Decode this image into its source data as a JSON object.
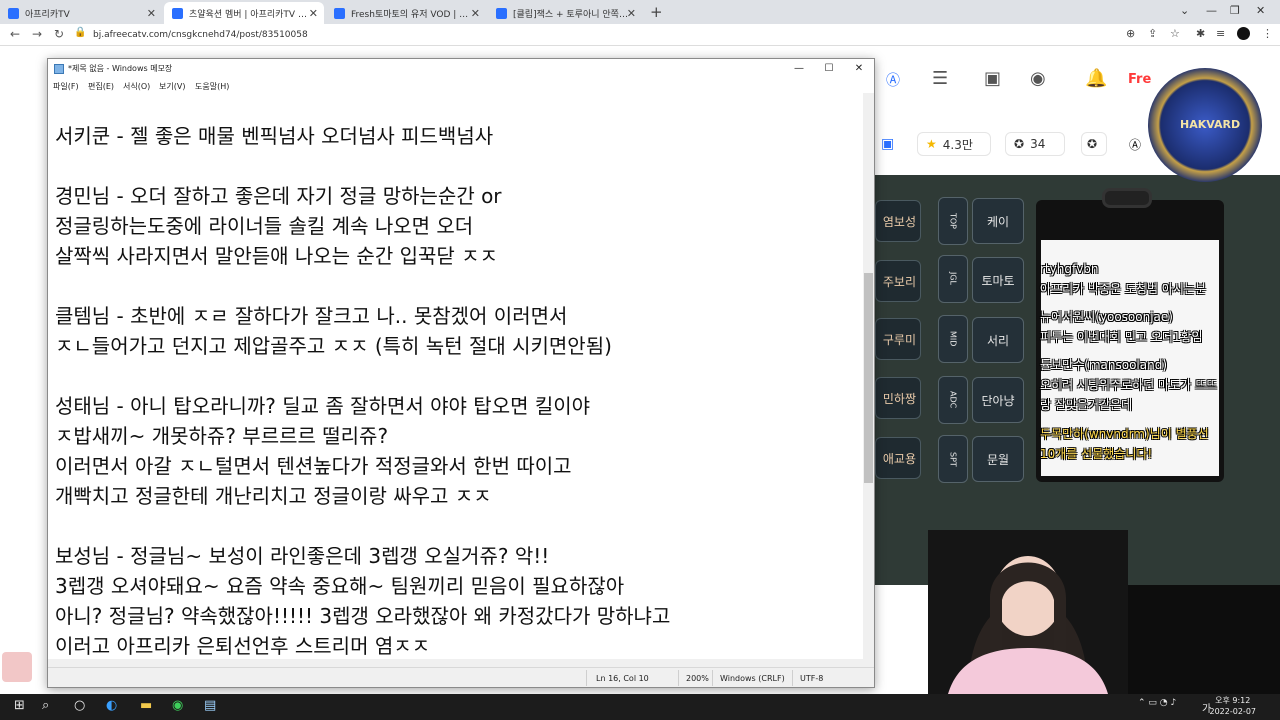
{
  "browser": {
    "tabs": [
      {
        "title": "아프리카TV",
        "color": "#2a6fff",
        "active": false
      },
      {
        "title": "츠얄육션 멤버 | 아프리카TV 방송국",
        "color": "#2a6fff",
        "active": true
      },
      {
        "title": "Fresh토마토의 유저 VOD | 아프리카",
        "color": "#2a6fff",
        "active": false
      },
      {
        "title": "[클립]잭스 + 토루아니 안쪽어요",
        "color": "#2a6fff",
        "active": false
      }
    ],
    "new_tab": "+",
    "url": "bj.afreecatv.com/cnsgkcnehd74/post/83510058"
  },
  "site": {
    "fresh_label": "Fre",
    "stats": [
      {
        "icon": "★",
        "value": "4.3만"
      },
      {
        "icon": "✪",
        "value": "34"
      }
    ]
  },
  "stream": {
    "left_tiles": [
      "염보성",
      "주보리",
      "구루미",
      "민하짱",
      "애교용"
    ],
    "lane_codes": [
      "TOP",
      "JGL",
      "MID",
      "ADC",
      "SPT"
    ],
    "lane_tiles": [
      "케이",
      "토마토",
      "서리",
      "단아냥",
      "문월"
    ],
    "emblem_text": "HAKVARD",
    "chat": [
      {
        "text": "rtyhgfvbn",
        "gift": false
      },
      {
        "text": "아프리카 박종운 도청범 아시는분",
        "gift": false
      },
      {
        "text": "뉴어서원씨(yoosoonjae)",
        "gift": false
      },
      {
        "text": "피투는 이번대회 민고 오더1황임",
        "gift": false
      },
      {
        "text": "튤보만수(mansooland)",
        "gift": false
      },
      {
        "text": "오히려 시팅위주로하던 마토가 뜨뜨",
        "gift": false
      },
      {
        "text": "랑 잘맞을거같은데",
        "gift": false
      },
      {
        "text": "두목만하(wnvndrm)님이 별풍선",
        "gift": true
      },
      {
        "text": "10개를 선물했습니다!",
        "gift": true
      }
    ]
  },
  "notepad": {
    "title": "*제목 없음 - Windows 메모장",
    "menu": [
      "파일(F)",
      "편집(E)",
      "서식(O)",
      "보기(V)",
      "도움말(H)"
    ],
    "lines": [
      "서키쿤 - 젤 좋은 매물 벤픽넘사 오더넘사 피드백넘사",
      "",
      "경민님 - 오더 잘하고 좋은데 자기 정글 망하는순간 or",
      "정글링하는도중에 라이너들 솔킬 계속 나오면 오더",
      "살짝씩 사라지면서 말안듣애 나오는 순간 입꾹닫 ㅈㅈ",
      "",
      "클템님 - 초반에 ㅈㄹ 잘하다가 잘크고 나.. 못참겠어 이러면서",
      "ㅈㄴ들어가고 던지고 제압골주고 ㅈㅈ (특히 녹턴 절대 시키면안됨)",
      "",
      "성태님 - 아니 탑오라니까? 딜교 좀 잘하면서 야야 탑오면 킬이야",
      "ㅈ밥새끼~ 개못하쥬? 부르르르 떨리쥬?",
      "이러면서 아갈 ㅈㄴ털면서 텐션높다가 적정글와서 한번 따이고",
      "개빡치고 정글한테 개난리치고 정글이랑 싸우고 ㅈㅈ",
      "",
      "보성님 - 정글님~ 보성이 라인좋은데 3렙갱 오실거쥬? 악!!",
      "3렙갱 오셔야돼요~ 요즘 약속 중요해~ 팀원끼리 믿음이 필요하잖아",
      "아니? 정글님? 약속했잖아!!!!! 3렙갱 오라했잖아 왜 카정갔다가 망하냐고",
      "이러고 아프리카 은퇴선언후 스트리머 염ㅈㅈ"
    ],
    "status": {
      "position": "Ln 16, Col 10",
      "zoom": "200%",
      "line_ending": "Windows (CRLF)",
      "encoding": "UTF-8"
    }
  },
  "taskbar": {
    "time": "오후 9:12",
    "date": "2022-02-07",
    "lang": "가"
  }
}
